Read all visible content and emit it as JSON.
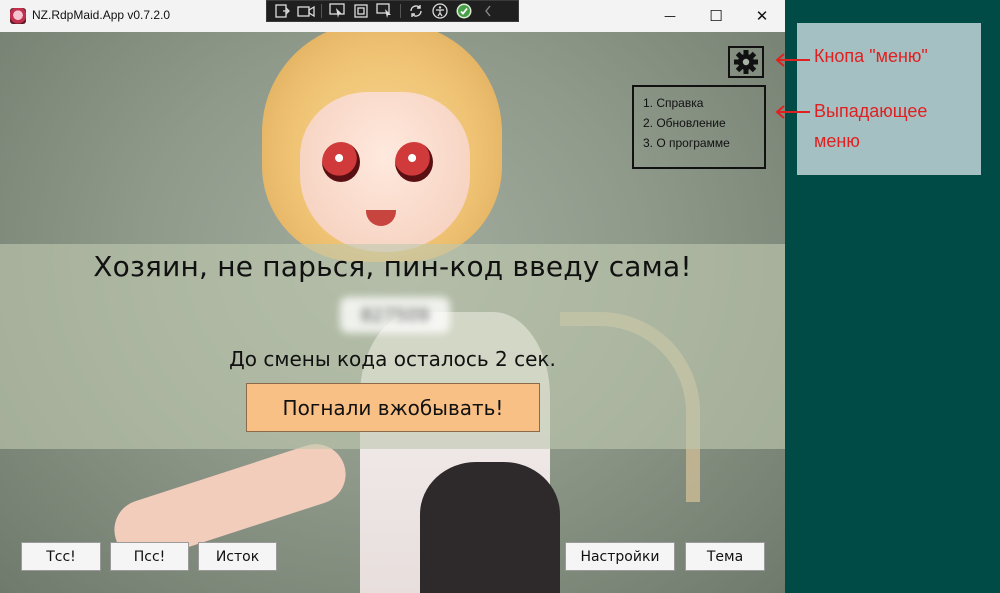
{
  "window": {
    "title": "NZ.RdpMaid.App v0.7.2.0",
    "minimize_glyph": "—",
    "maximize_glyph": "☐",
    "close_glyph": "✕"
  },
  "rdp_toolbar": {
    "icons": [
      "connection-info-icon",
      "video-icon",
      "remote-select-icon",
      "fullscreen-icon",
      "multi-monitor-icon",
      "sync-icon",
      "accessibility-icon",
      "check-icon",
      "collapse-icon"
    ]
  },
  "main": {
    "headline": "Хозяин, не парься, пин-код введу сама!",
    "pin_code": "827509",
    "countdown": "До смены кода осталось 2 сек.",
    "go_button": "Погнали вжобывать!"
  },
  "menu": {
    "items": [
      "1. Справка",
      "2. Обновление",
      "3. О программе"
    ]
  },
  "bottom_buttons": {
    "tss": "Тсс!",
    "pss": "Псс!",
    "source": "Исток",
    "settings": "Настройки",
    "theme": "Тема"
  },
  "annotations": {
    "menu_button_label": "Кнопа \"меню\"",
    "dropdown_label_line1": "Выпадающее",
    "dropdown_label_line2": "меню",
    "color": "#e02020"
  }
}
